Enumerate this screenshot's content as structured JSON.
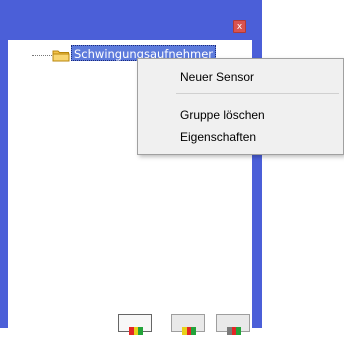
{
  "window": {
    "close_label": "x"
  },
  "tree": {
    "root_label": "Schwingungsaufnehmer"
  },
  "context_menu": {
    "items": [
      {
        "label": "Neuer Sensor"
      },
      {
        "label": "Gruppe löschen"
      },
      {
        "label": "Eigenschaften"
      }
    ]
  },
  "colors": {
    "panel_bg": "#4b5fd8",
    "selection": "#5d7bdc",
    "close_button": "#d9534f"
  },
  "icons": {
    "folder": "folder-icon",
    "toolbar": [
      "color-bar-icon",
      "color-bar-icon",
      "color-bar-icon"
    ]
  }
}
